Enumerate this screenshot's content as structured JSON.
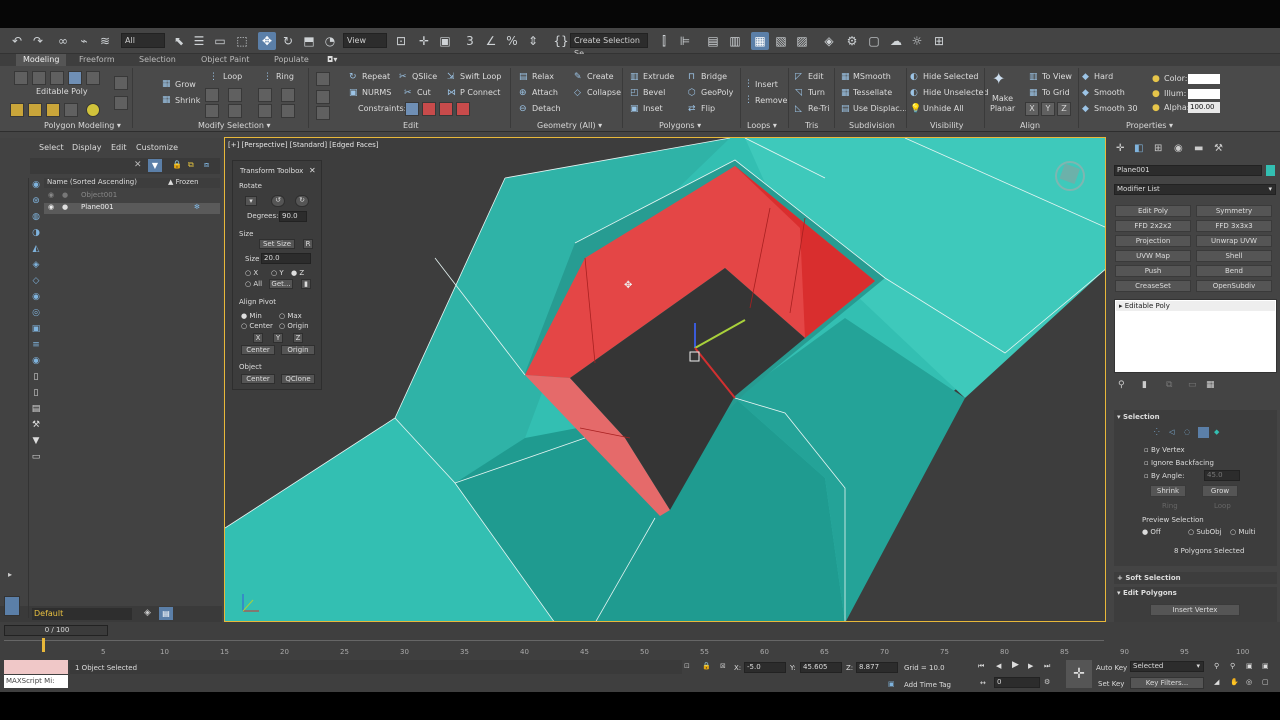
{
  "toolbar": {
    "filter_all": "All",
    "view_dropdown": "View",
    "create_selection_set": "Create Selection Se"
  },
  "ribbon_tabs": [
    "Modeling",
    "Freeform",
    "Selection",
    "Object Paint",
    "Populate"
  ],
  "ribbon": {
    "editable_poly": "Editable Poly",
    "grow": "Grow",
    "shrink": "Shrink",
    "loop": "Loop",
    "ring": "Ring",
    "repeat": "Repeat",
    "qslice": "QSlice",
    "swift_loop": "Swift Loop",
    "nurms": "NURMS",
    "cut": "Cut",
    "p_connect": "P Connect",
    "constraints": "Constraints:",
    "relax": "Relax",
    "create": "Create",
    "attach": "Attach",
    "collapse": "Collapse",
    "detach": "Detach",
    "extrude": "Extrude",
    "bridge": "Bridge",
    "bevel": "Bevel",
    "geopoly": "GeoPoly",
    "inset": "Inset",
    "flip": "Flip",
    "insert": "Insert",
    "remove": "Remove",
    "edit": "Edit",
    "turn": "Turn",
    "retri": "Re-Tri",
    "msmooth": "MSmooth",
    "tessellate": "Tessellate",
    "use_displac": "Use Displac...",
    "hide_selected": "Hide Selected",
    "hide_unselected": "Hide Unselected",
    "unhide_all": "Unhide All",
    "make_planar_1": "Make",
    "make_planar_2": "Planar",
    "to_view": "To View",
    "to_grid": "To Grid",
    "x": "X",
    "y": "Y",
    "z": "Z",
    "hard": "Hard",
    "smooth": "Smooth",
    "smooth30": "Smooth 30",
    "color": "Color:",
    "illum": "Illum:",
    "alpha": "Alpha:",
    "alpha_val": "100.00",
    "groups": {
      "polygon_modeling": "Polygon Modeling",
      "modify_selection": "Modify Selection",
      "edit": "Edit",
      "geometry": "Geometry (All)",
      "polygons": "Polygons",
      "loops": "Loops",
      "tris": "Tris",
      "subdivision": "Subdivision",
      "visibility": "Visibility",
      "align": "Align",
      "properties": "Properties"
    }
  },
  "scene_explorer": {
    "menu": [
      "Select",
      "Display",
      "Edit",
      "Customize"
    ],
    "col_name": "Name (Sorted Ascending)",
    "col_frozen": "▲ Frozen",
    "items": [
      "Object001",
      "Plane001"
    ],
    "layer": "Default"
  },
  "viewport": {
    "label": "[+] [Perspective] [Standard] [Edged Faces]"
  },
  "transform_toolbox": {
    "title": "Transform Toolbox",
    "rotate": "Rotate",
    "degrees_label": "Degrees:",
    "degrees": "90.0",
    "size": "Size",
    "set_size": "Set Size",
    "r": "R",
    "size_label": "Size",
    "size_val": "20.0",
    "x": "X",
    "y": "Y",
    "z": "Z",
    "all": "All",
    "get": "Get...",
    "align_pivot": "Align Pivot",
    "min": "Min",
    "max": "Max",
    "center": "Center",
    "origin": "Origin",
    "bx": "X",
    "by": "Y",
    "bz": "Z",
    "center_btn": "Center",
    "origin_btn": "Origin",
    "object": "Object",
    "obj_center": "Center",
    "qclone": "QClone"
  },
  "command_panel": {
    "object_name": "Plane001",
    "modifier_list": "Modifier List",
    "modifiers": [
      "Edit Poly",
      "Symmetry",
      "FFD 2x2x2",
      "FFD 3x3x3",
      "Projection",
      "Unwrap UVW",
      "UVW Map",
      "Shell",
      "Push",
      "Bend",
      "CreaseSet",
      "OpenSubdiv"
    ],
    "stack_item": "Editable Poly",
    "selection": "Selection",
    "by_vertex": "By Vertex",
    "ignore_backfacing": "Ignore Backfacing",
    "by_angle": "By Angle:",
    "by_angle_val": "45.0",
    "shrink": "Shrink",
    "grow": "Grow",
    "ring": "Ring",
    "loop": "Loop",
    "preview_selection": "Preview Selection",
    "off": "Off",
    "subobj": "SubObj",
    "multi": "Multi",
    "status": "8 Polygons Selected",
    "soft_selection": "Soft Selection",
    "edit_polygons": "Edit Polygons",
    "insert_vertex": "Insert Vertex"
  },
  "timeline": {
    "frame": "0 / 100",
    "ticks": [
      "5",
      "10",
      "15",
      "20",
      "25",
      "30",
      "35",
      "40",
      "45",
      "50",
      "55",
      "60",
      "65",
      "70",
      "75",
      "80",
      "85",
      "90",
      "95",
      "100"
    ]
  },
  "status": {
    "maxscript": "MAXScript Mi:",
    "selected": "1 Object Selected",
    "x_label": "X:",
    "x": "-5.0",
    "y_label": "Y:",
    "y": "45.605",
    "z_label": "Z:",
    "z": "8.877",
    "grid": "Grid = 10.0",
    "add_time_tag": "Add Time Tag",
    "auto_key": "Auto Key",
    "selected_dd": "Selected",
    "set_key": "Set Key",
    "key_filters": "Key Filters...",
    "frame": "0"
  },
  "colors": {
    "teal": "#33bfb2",
    "teal_dark": "#1f8f86",
    "red": "#e43a3a",
    "red_light": "#e56060",
    "accent": "#5b7fa8"
  }
}
